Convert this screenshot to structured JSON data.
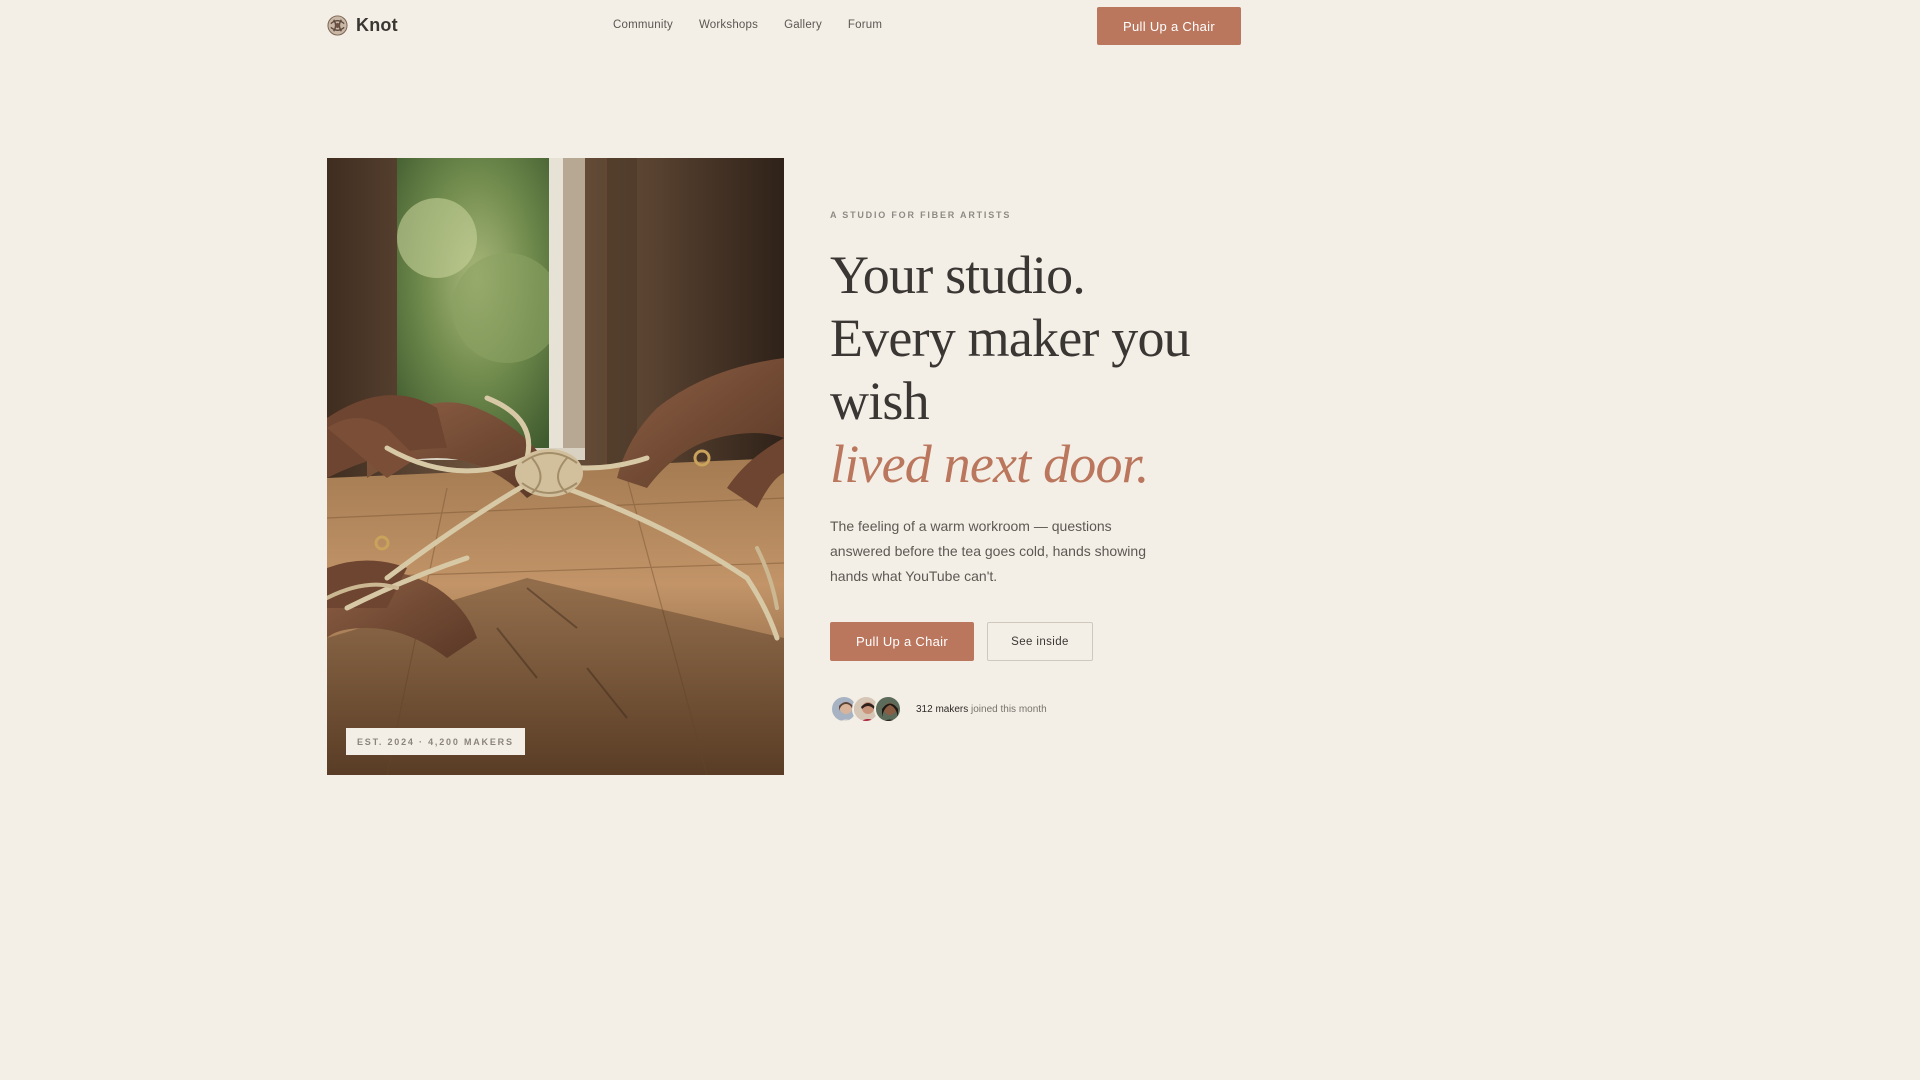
{
  "brand": {
    "name": "Knot",
    "icon": "knot-logo-icon"
  },
  "nav": {
    "links": [
      {
        "label": "Community"
      },
      {
        "label": "Workshops"
      },
      {
        "label": "Gallery"
      },
      {
        "label": "Forum"
      }
    ],
    "cta_label": "Pull Up a Chair"
  },
  "hero": {
    "image_badge": "EST. 2024 · 4,200 MAKERS",
    "eyebrow": "A STUDIO FOR FIBER ARTISTS",
    "headline_line_1": "Your studio.",
    "headline_line_2": "Every maker you wish",
    "headline_accent": "lived next door.",
    "lead": "The feeling of a warm workroom — questions answered before the tea goes cold, hands showing hands what YouTube can't.",
    "primary_cta": "Pull Up a Chair",
    "secondary_cta": "See inside",
    "social_proof": {
      "count": "312 makers",
      "suffix": " joined this month"
    }
  },
  "colors": {
    "background": "#f4efe6",
    "accent": "#bb775e",
    "text": "#3a3633"
  }
}
